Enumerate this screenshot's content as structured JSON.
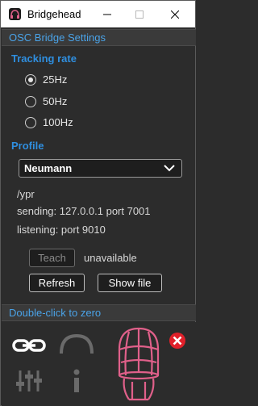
{
  "window": {
    "title": "Bridgehead"
  },
  "colors": {
    "accent": "#2f8fe0",
    "head": "#e0608a",
    "close_badge": "#e0202a"
  },
  "osc_section": {
    "label": "OSC Bridge Settings"
  },
  "tracking": {
    "label": "Tracking rate",
    "options": [
      {
        "label": "25Hz",
        "selected": true
      },
      {
        "label": "50Hz",
        "selected": false
      },
      {
        "label": "100Hz",
        "selected": false
      }
    ]
  },
  "profile": {
    "label": "Profile",
    "selected": "Neumann",
    "path": "/ypr",
    "sending": "sending: 127.0.0.1 port 7001",
    "listening": "listening: port 9010"
  },
  "actions": {
    "teach_label": "Teach",
    "teach_status": "unavailable",
    "refresh_label": "Refresh",
    "show_file_label": "Show file"
  },
  "zero_section": {
    "label": "Double-click to zero"
  },
  "icons": {
    "connect": "link-icon",
    "headphones": "headphones-icon",
    "head": "head-icon",
    "close_badge": "close-icon",
    "sliders": "sliders-icon",
    "info": "info-icon"
  }
}
